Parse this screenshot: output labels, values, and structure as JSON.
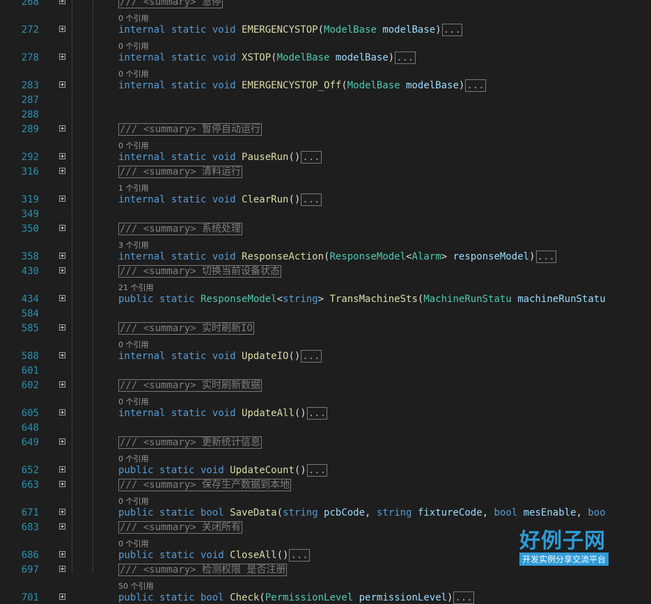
{
  "editor": {
    "lines": [
      {
        "num": "268",
        "refs": "",
        "parts": [
          {
            "c": "sum",
            "t": "/// <summary> 急停"
          }
        ],
        "fold": true
      },
      {
        "num": "272",
        "refs": "0 个引用",
        "parts": [
          {
            "c": "kw",
            "t": "internal static void "
          },
          {
            "c": "fn",
            "t": "EMERGENCYSTOP"
          },
          {
            "c": "pn",
            "t": "("
          },
          {
            "c": "ty",
            "t": "ModelBase"
          },
          {
            "c": "id",
            "t": " modelBase"
          },
          {
            "c": "pn",
            "t": ")"
          }
        ],
        "dots": true,
        "fold": true
      },
      {
        "num": "278",
        "refs": "0 个引用",
        "parts": [
          {
            "c": "kw",
            "t": "internal static void "
          },
          {
            "c": "fn",
            "t": "XSTOP"
          },
          {
            "c": "pn",
            "t": "("
          },
          {
            "c": "ty",
            "t": "ModelBase"
          },
          {
            "c": "id",
            "t": " modelBase"
          },
          {
            "c": "pn",
            "t": ")"
          }
        ],
        "dots": true,
        "fold": true
      },
      {
        "num": "283",
        "refs": "0 个引用",
        "parts": [
          {
            "c": "kw",
            "t": "internal static void "
          },
          {
            "c": "fn",
            "t": "EMERGENCYSTOP_Off"
          },
          {
            "c": "pn",
            "t": "("
          },
          {
            "c": "ty",
            "t": "ModelBase"
          },
          {
            "c": "id",
            "t": " modelBase"
          },
          {
            "c": "pn",
            "t": ")"
          }
        ],
        "dots": true,
        "fold": true
      },
      {
        "num": "287",
        "refs": "",
        "parts": []
      },
      {
        "num": "288",
        "refs": "",
        "parts": []
      },
      {
        "num": "289",
        "refs": "",
        "parts": [
          {
            "c": "sum",
            "t": "/// <summary> 暂停自动运行"
          }
        ],
        "fold": true
      },
      {
        "num": "292",
        "refs": "0 个引用",
        "parts": [
          {
            "c": "kw",
            "t": "internal static void "
          },
          {
            "c": "fn",
            "t": "PauseRun"
          },
          {
            "c": "pn",
            "t": "()"
          }
        ],
        "dots": true,
        "fold": true
      },
      {
        "num": "316",
        "refs": "",
        "parts": [
          {
            "c": "sum",
            "t": "/// <summary> 清料运行"
          }
        ],
        "fold": true
      },
      {
        "num": "319",
        "refs": "1 个引用",
        "parts": [
          {
            "c": "kw",
            "t": "internal static void "
          },
          {
            "c": "fn",
            "t": "ClearRun"
          },
          {
            "c": "pn",
            "t": "()"
          }
        ],
        "dots": true,
        "fold": true
      },
      {
        "num": "349",
        "refs": "",
        "parts": []
      },
      {
        "num": "350",
        "refs": "",
        "parts": [
          {
            "c": "sum",
            "t": "/// <summary> 系统处理"
          }
        ],
        "fold": true
      },
      {
        "num": "358",
        "refs": "3 个引用",
        "parts": [
          {
            "c": "kw",
            "t": "internal static void "
          },
          {
            "c": "fn",
            "t": "ResponseAction"
          },
          {
            "c": "pn",
            "t": "("
          },
          {
            "c": "ty",
            "t": "ResponseModel"
          },
          {
            "c": "pn",
            "t": "<"
          },
          {
            "c": "ty",
            "t": "Alarm"
          },
          {
            "c": "pn",
            "t": ">"
          },
          {
            "c": "id",
            "t": " responseModel"
          },
          {
            "c": "pn",
            "t": ")"
          }
        ],
        "dots": true,
        "fold": true
      },
      {
        "num": "430",
        "refs": "",
        "parts": [
          {
            "c": "sum",
            "t": "/// <summary> 切换当前设备状态"
          }
        ],
        "fold": true
      },
      {
        "num": "434",
        "refs": "21 个引用",
        "parts": [
          {
            "c": "kw",
            "t": "public static "
          },
          {
            "c": "ty",
            "t": "ResponseModel"
          },
          {
            "c": "pn",
            "t": "<"
          },
          {
            "c": "kw",
            "t": "string"
          },
          {
            "c": "pn",
            "t": "> "
          },
          {
            "c": "fn",
            "t": "TransMachineSts"
          },
          {
            "c": "pn",
            "t": "("
          },
          {
            "c": "ty",
            "t": "MachineRunStatu"
          },
          {
            "c": "id",
            "t": " machineRunStatu"
          }
        ],
        "fold": true
      },
      {
        "num": "584",
        "refs": "",
        "parts": []
      },
      {
        "num": "585",
        "refs": "",
        "parts": [
          {
            "c": "sum",
            "t": "/// <summary> 实时刷新IO"
          }
        ],
        "fold": true
      },
      {
        "num": "588",
        "refs": "0 个引用",
        "parts": [
          {
            "c": "kw",
            "t": "internal static void "
          },
          {
            "c": "fn",
            "t": "UpdateIO"
          },
          {
            "c": "pn",
            "t": "()"
          }
        ],
        "dots": true,
        "fold": true
      },
      {
        "num": "601",
        "refs": "",
        "parts": []
      },
      {
        "num": "602",
        "refs": "",
        "parts": [
          {
            "c": "sum",
            "t": "/// <summary> 实时刷新数据"
          }
        ],
        "fold": true
      },
      {
        "num": "605",
        "refs": "0 个引用",
        "parts": [
          {
            "c": "kw",
            "t": "internal static void "
          },
          {
            "c": "fn",
            "t": "UpdateAll"
          },
          {
            "c": "pn",
            "t": "()"
          }
        ],
        "dots": true,
        "fold": true
      },
      {
        "num": "648",
        "refs": "",
        "parts": []
      },
      {
        "num": "649",
        "refs": "",
        "parts": [
          {
            "c": "sum",
            "t": "/// <summary> 更新统计信息"
          }
        ],
        "fold": true
      },
      {
        "num": "652",
        "refs": "0 个引用",
        "parts": [
          {
            "c": "kw",
            "t": "public static void "
          },
          {
            "c": "fn",
            "t": "UpdateCount"
          },
          {
            "c": "pn",
            "t": "()"
          }
        ],
        "dots": true,
        "fold": true
      },
      {
        "num": "663",
        "refs": "",
        "parts": [
          {
            "c": "sum",
            "t": "/// <summary> 保存生产数据到本地"
          }
        ],
        "fold": true
      },
      {
        "num": "671",
        "refs": "0 个引用",
        "parts": [
          {
            "c": "kw",
            "t": "public static bool "
          },
          {
            "c": "fn",
            "t": "SaveData"
          },
          {
            "c": "pn",
            "t": "("
          },
          {
            "c": "kw",
            "t": "string"
          },
          {
            "c": "id",
            "t": " pcbCode"
          },
          {
            "c": "pn",
            "t": ", "
          },
          {
            "c": "kw",
            "t": "string"
          },
          {
            "c": "id",
            "t": " fixtureCode"
          },
          {
            "c": "pn",
            "t": ", "
          },
          {
            "c": "kw",
            "t": "bool"
          },
          {
            "c": "id",
            "t": " mesEnable"
          },
          {
            "c": "pn",
            "t": ", "
          },
          {
            "c": "kw",
            "t": "boo"
          }
        ],
        "fold": true
      },
      {
        "num": "683",
        "refs": "",
        "parts": [
          {
            "c": "sum",
            "t": "/// <summary> 关闭所有"
          }
        ],
        "fold": true
      },
      {
        "num": "686",
        "refs": "0 个引用",
        "parts": [
          {
            "c": "kw",
            "t": "public static void "
          },
          {
            "c": "fn",
            "t": "CloseAll"
          },
          {
            "c": "pn",
            "t": "()"
          }
        ],
        "dots": true,
        "fold": true
      },
      {
        "num": "697",
        "refs": "",
        "parts": [
          {
            "c": "sum",
            "t": "/// <summary> 检测权限  是否注册"
          }
        ],
        "fold": true
      },
      {
        "num": "701",
        "refs": "50 个引用",
        "parts": [
          {
            "c": "kw",
            "t": "public static bool "
          },
          {
            "c": "fn",
            "t": "Check"
          },
          {
            "c": "pn",
            "t": "("
          },
          {
            "c": "ty",
            "t": "PermissionLevel"
          },
          {
            "c": "id",
            "t": " permissionLevel"
          },
          {
            "c": "pn",
            "t": ")"
          }
        ],
        "dots": true,
        "fold": true
      }
    ],
    "collapsed_marker": "...",
    "colors": {
      "background": "#1e1e1e",
      "line_number": "#2b91af",
      "keyword": "#569cd6",
      "type": "#4ec9b0",
      "method": "#dcdcaa",
      "parameter": "#9cdcfe"
    }
  },
  "watermark": {
    "logo_text": "好例子网",
    "tagline": "开发实例分享交流平台"
  }
}
